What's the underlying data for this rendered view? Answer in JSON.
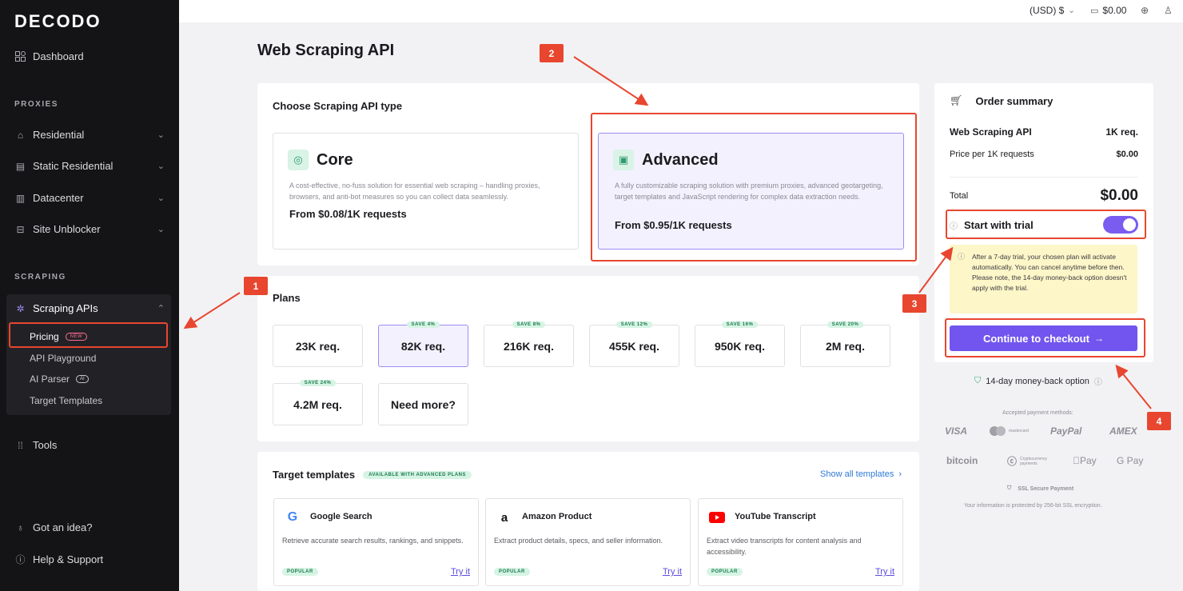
{
  "sidebar": {
    "logo": "DECODO",
    "dashboard": "Dashboard",
    "proxies_label": "PROXIES",
    "proxies": [
      "Residential",
      "Static Residential",
      "Datacenter",
      "Site Unblocker"
    ],
    "scraping_label": "SCRAPING",
    "scraping_apis": "Scraping APIs",
    "sub": {
      "pricing": "Pricing",
      "pricing_badge": "NEW",
      "api_playground": "API Playground",
      "ai_parser": "AI Parser",
      "ai_badge": "AI",
      "target_templates": "Target Templates"
    },
    "tools": "Tools",
    "idea": "Got an idea?",
    "help": "Help & Support"
  },
  "topbar": {
    "currency": "(USD) $",
    "cart": "$0.00"
  },
  "page_title": "Web Scraping API",
  "api_type": {
    "heading": "Choose Scraping API type",
    "core": {
      "name": "Core",
      "desc": "A cost-effective, no-fuss solution for essential web scraping – handling proxies, browsers, and anti-bot measures so you can collect data seamlessly.",
      "price": "From $0.08/1K requests"
    },
    "advanced": {
      "name": "Advanced",
      "desc": "A fully customizable scraping solution with premium proxies, advanced geotargeting, target templates and JavaScript rendering for complex data extraction needs.",
      "price": "From $0.95/1K requests"
    }
  },
  "plans": {
    "heading": "Plans",
    "items": [
      {
        "label": "23K req.",
        "save": ""
      },
      {
        "label": "82K req.",
        "save": "SAVE 4%"
      },
      {
        "label": "216K req.",
        "save": "SAVE 8%"
      },
      {
        "label": "455K req.",
        "save": "SAVE 12%"
      },
      {
        "label": "950K req.",
        "save": "SAVE 16%"
      },
      {
        "label": "2M req.",
        "save": "SAVE 20%"
      },
      {
        "label": "4.2M req.",
        "save": "SAVE 24%"
      },
      {
        "label": "Need more?",
        "save": ""
      }
    ]
  },
  "templates": {
    "heading": "Target templates",
    "badge": "AVAILABLE WITH ADVANCED PLANS",
    "show_all": "Show all templates",
    "items": [
      {
        "title": "Google Search",
        "desc": "Retrieve accurate search results, rankings, and snippets.",
        "tag": "POPULAR",
        "try": "Try it"
      },
      {
        "title": "Amazon Product",
        "desc": "Extract product details, specs, and seller information.",
        "tag": "POPULAR",
        "try": "Try it"
      },
      {
        "title": "YouTube Transcript",
        "desc": "Extract video transcripts for content analysis and accessibility.",
        "tag": "POPULAR",
        "try": "Try it"
      }
    ]
  },
  "summary": {
    "title": "Order summary",
    "product": "Web Scraping API",
    "product_qty": "1K req.",
    "price_label": "Price per 1K requests",
    "price_value": "$0.00",
    "total_label": "Total",
    "total_value": "$0.00",
    "trial_label": "Start with trial",
    "trial_on": true,
    "trial_note": "After a 7-day trial, your chosen plan will activate automatically. You can cancel anytime before then. Please note, the 14-day money-back option doesn't apply with the trial.",
    "checkout": "Continue to checkout"
  },
  "money_back": "14-day money-back option",
  "payments": {
    "label": "Accepted payment methods:",
    "methods": [
      "VISA",
      "mastercard",
      "PayPal",
      "AMEX",
      "bitcoin",
      "Cryptocurrency payments",
      "Pay",
      "G Pay"
    ],
    "ssl": "SSL Secure Payment",
    "ssl_note": "Your information is protected by 256-bit SSL encryption."
  },
  "annotations": [
    "1",
    "2",
    "3",
    "4"
  ],
  "colors": {
    "accent": "#7155ee",
    "annotation": "#e8462f",
    "sidebar": "#141416"
  }
}
